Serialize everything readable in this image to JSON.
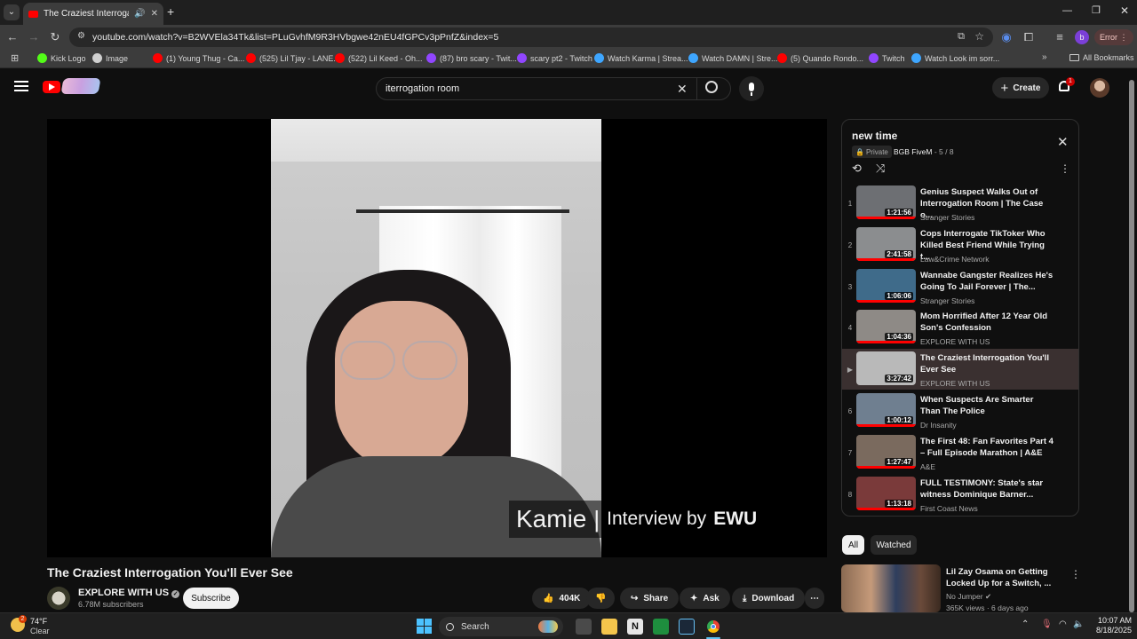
{
  "browser": {
    "active_tab": "The Craziest Interrogation You'll Ever See",
    "url": "youtube.com/watch?v=B2WVEla34Tk&list=PLuGvhfM9R3HVbgwe42nEU4fGPCv3pPnfZ&index=5",
    "profile_initial": "b",
    "error_label": "Error",
    "bookmarks": [
      {
        "label": "Kick Logo",
        "color": "#53fc18"
      },
      {
        "label": "Image",
        "color": "#cfcfcf"
      },
      {
        "label": "(1) Young Thug - Ca...",
        "color": "#ff0000"
      },
      {
        "label": "(525) Lil Tjay - LANE...",
        "color": "#ff0000"
      },
      {
        "label": "(522) Lil Keed - Oh...",
        "color": "#ff0000"
      },
      {
        "label": "(87) bro scary - Twit...",
        "color": "#9146ff"
      },
      {
        "label": "scary pt2 - Twitch",
        "color": "#9146ff"
      },
      {
        "label": "Watch Karma | Strea...",
        "color": "#3ea6ff"
      },
      {
        "label": "Watch DAMN | Stre...",
        "color": "#3ea6ff"
      },
      {
        "label": "(5) Quando Rondo...",
        "color": "#ff0000"
      },
      {
        "label": "Twitch",
        "color": "#9146ff"
      },
      {
        "label": "Watch Look im sorr...",
        "color": "#3ea6ff"
      }
    ],
    "all_bookmarks": "All Bookmarks"
  },
  "youtube": {
    "search_query": "iterrogation room",
    "create_label": "Create",
    "notification_count": "1",
    "video_overlay_name": "Kamie",
    "video_overlay_sep": "|",
    "video_overlay_text": "Interview by",
    "video_overlay_brand": "EWU",
    "video_title": "The Craziest Interrogation You'll Ever See",
    "channel_name": "EXPLORE WITH US",
    "subscribers": "6.78M subscribers",
    "subscribe_label": "Subscribe",
    "likes": "404K",
    "share_label": "Share",
    "ask_label": "Ask",
    "download_label": "Download"
  },
  "playlist": {
    "title": "new time",
    "privacy": "Private",
    "owner": "BGB FiveM",
    "position": "- 5 / 8",
    "items": [
      {
        "index": "1",
        "title": "Genius Suspect Walks Out of Interrogation Room | The Case o...",
        "channel": "Stranger Stories",
        "duration": "1:21:56",
        "progress": 1.0,
        "thumb": "#6d6f73"
      },
      {
        "index": "2",
        "title": "Cops Interrogate TikToker Who Killed Best Friend While Trying t...",
        "channel": "Law&Crime Network",
        "duration": "2:41:58",
        "progress": 1.0,
        "thumb": "#8b8d8f"
      },
      {
        "index": "3",
        "title": "Wannabe Gangster Realizes He's Going To Jail Forever | The...",
        "channel": "Stranger Stories",
        "duration": "1:06:06",
        "progress": 1.0,
        "thumb": "#3f6b8a"
      },
      {
        "index": "4",
        "title": "Mom Horrified After 12 Year Old Son's Confession",
        "channel": "EXPLORE WITH US",
        "duration": "1:04:36",
        "progress": 1.0,
        "thumb": "#8e8a86"
      },
      {
        "index": "▶",
        "title": "The Craziest Interrogation You'll Ever See",
        "channel": "EXPLORE WITH US",
        "duration": "3:27:42",
        "progress": 0.0,
        "thumb": "#b9b9b9"
      },
      {
        "index": "6",
        "title": "When Suspects Are Smarter Than The Police",
        "channel": "Dr Insanity",
        "duration": "1:00:12",
        "progress": 1.0,
        "thumb": "#6f7f90"
      },
      {
        "index": "7",
        "title": "The First 48: Fan Favorites Part 4 – Full Episode Marathon | A&E",
        "channel": "A&E",
        "duration": "1:27:47",
        "progress": 1.0,
        "thumb": "#7a6a5e"
      },
      {
        "index": "8",
        "title": "FULL TESTIMONY: State's star witness Dominique Barner...",
        "channel": "First Coast News",
        "duration": "1:13:18",
        "progress": 1.0,
        "thumb": "#7a3a3a"
      }
    ]
  },
  "filters": {
    "all": "All",
    "watched": "Watched"
  },
  "recommended": {
    "title": "Lil Zay Osama on Getting Locked Up for a Switch, ...",
    "channel": "No Jumper",
    "meta": "365K views · 6 days ago"
  },
  "taskbar": {
    "weather_temp": "74°F",
    "weather_desc": "Clear",
    "weather_badge": "2",
    "search_label": "Search",
    "time": "10:07 AM",
    "date": "8/18/2025"
  }
}
